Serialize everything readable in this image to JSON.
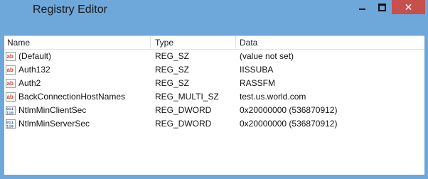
{
  "window": {
    "title": "Registry Editor",
    "controls": {
      "minimize": "minimize",
      "maximize": "maximize",
      "close": "✕"
    }
  },
  "columns": {
    "name": "Name",
    "type": "Type",
    "data": "Data"
  },
  "rows": [
    {
      "icon": "string-value-icon",
      "name": "(Default)",
      "type": "REG_SZ",
      "data": "(value not set)"
    },
    {
      "icon": "string-value-icon",
      "name": "Auth132",
      "type": "REG_SZ",
      "data": "IISSUBA"
    },
    {
      "icon": "string-value-icon",
      "name": "Auth2",
      "type": "REG_SZ",
      "data": "RASSFM"
    },
    {
      "icon": "string-value-icon",
      "name": "BackConnectionHostNames",
      "type": "REG_MULTI_SZ",
      "data": "test.us.world.com"
    },
    {
      "icon": "binary-value-icon",
      "name": "NtlmMinClientSec",
      "type": "REG_DWORD",
      "data": "0x20000000 (536870912)"
    },
    {
      "icon": "binary-value-icon",
      "name": "NtlmMinServerSec",
      "type": "REG_DWORD",
      "data": "0x20000000 (536870912)"
    }
  ],
  "colors": {
    "titlebar": "#6ea7da",
    "close_button": "#c7504c",
    "string_icon": "#d2452c",
    "binary_icon": "#2c5fa8"
  }
}
